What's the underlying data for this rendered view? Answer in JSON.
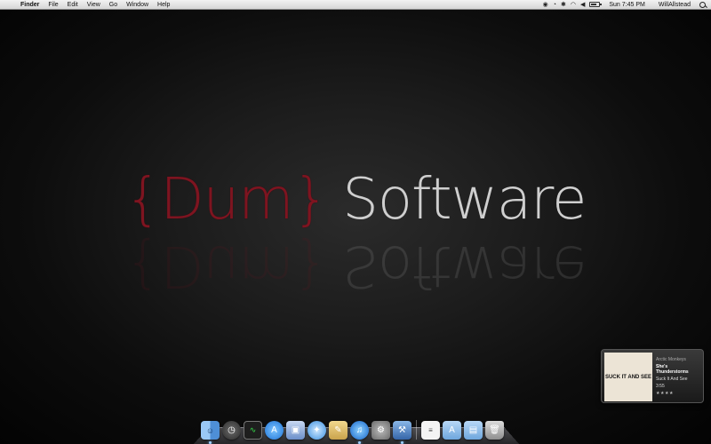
{
  "menubar": {
    "app_name": "Finder",
    "items": [
      "File",
      "Edit",
      "View",
      "Go",
      "Window",
      "Help"
    ],
    "clock": "Sun 7:45 PM",
    "user": "WillAllstead",
    "battery_level": 0.75
  },
  "logo": {
    "part1": "{Dum}",
    "part2": "Software",
    "colors": {
      "accent": "#7e1420",
      "text": "#cfcfcf"
    }
  },
  "now_playing": {
    "album_art_text": "SUCK IT AND SEE",
    "artist": "Arctic Monkeys",
    "title": "She's Thunderstorms",
    "album": "Suck It And See",
    "time": "3:55",
    "rating": "★★★★"
  },
  "dock": {
    "items": [
      {
        "name": "finder-icon",
        "glyph": "☺",
        "running": true
      },
      {
        "name": "dashboard-icon",
        "glyph": "◷",
        "running": false
      },
      {
        "name": "activity-monitor-icon",
        "glyph": "∿",
        "running": false
      },
      {
        "name": "app-store-icon",
        "glyph": "A",
        "running": false
      },
      {
        "name": "preview-icon",
        "glyph": "▣",
        "running": false
      },
      {
        "name": "safari-icon",
        "glyph": "✦",
        "running": false
      },
      {
        "name": "notes-icon",
        "glyph": "✎",
        "running": false
      },
      {
        "name": "itunes-icon",
        "glyph": "♫",
        "running": true
      },
      {
        "name": "system-preferences-icon",
        "glyph": "⚙",
        "running": false
      },
      {
        "name": "xcode-icon",
        "glyph": "⚒",
        "running": true
      }
    ],
    "stack_items": [
      {
        "name": "textedit-icon",
        "glyph": "≡"
      },
      {
        "name": "applications-folder-icon",
        "glyph": "A"
      },
      {
        "name": "documents-folder-icon",
        "glyph": "▤"
      },
      {
        "name": "trash-icon",
        "glyph": "🗑"
      }
    ]
  }
}
